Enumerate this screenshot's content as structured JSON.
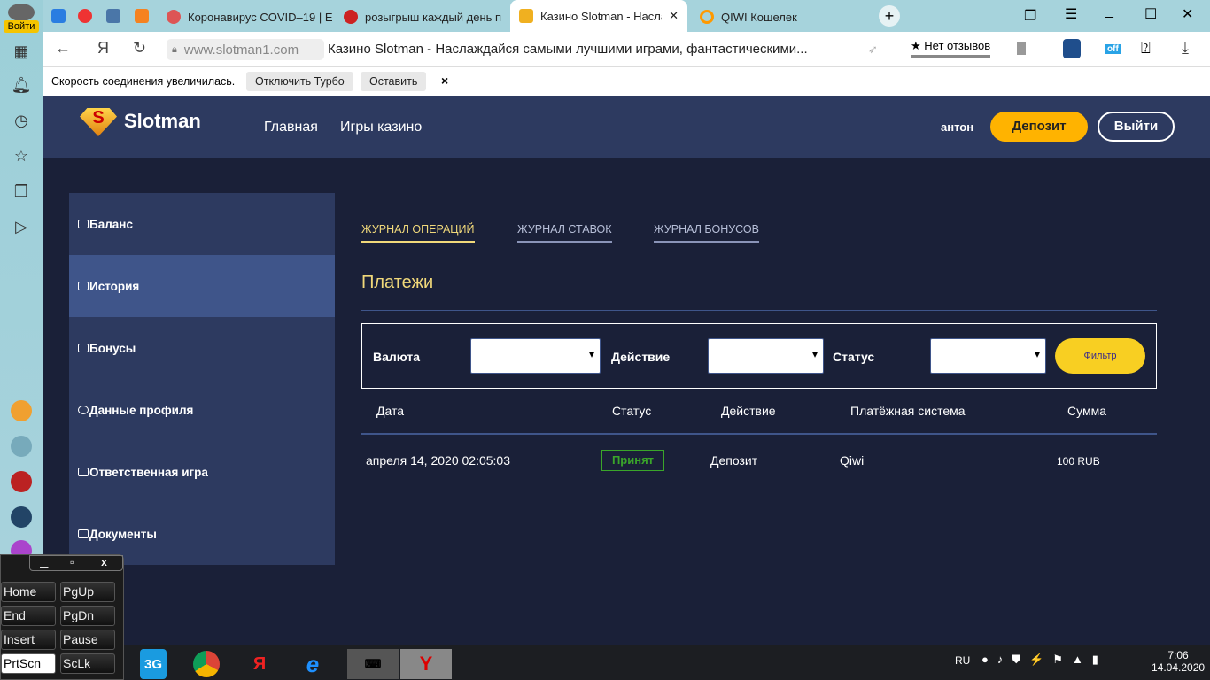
{
  "browser": {
    "login_label": "Войти",
    "tabs": [
      {
        "title": "Коронавирус COVID–19 | E"
      },
      {
        "title": "розыгрыш каждый день п"
      },
      {
        "title": "Казино Slotman - Насла"
      },
      {
        "title": "QIWI Кошелек"
      }
    ],
    "url": "www.slotman1.com",
    "page_title": "Казино Slotman - Наслаждайся самыми лучшими играми, фантастическими...",
    "reviews": "★ Нет отзывов",
    "ext_off": "off",
    "turbo": {
      "message": "Скорость соединения увеличилась.",
      "disable": "Отключить Турбо",
      "keep": "Оставить",
      "close": "×"
    }
  },
  "site": {
    "logo": "Slotman",
    "nav": [
      "Главная",
      "Игры казино"
    ],
    "username": "антон",
    "deposit": "Депозит",
    "logout": "Выйти",
    "sidebar": [
      {
        "label": "Баланс"
      },
      {
        "label": "История",
        "active": true
      },
      {
        "label": "Бонусы"
      },
      {
        "label": "Данные профиля"
      },
      {
        "label": "Ответственная игра"
      },
      {
        "label": "Документы"
      }
    ],
    "tabs": [
      "ЖУРНАЛ ОПЕРАЦИЙ",
      "ЖУРНАЛ СТАВОК",
      "ЖУРНАЛ БОНУСОВ"
    ],
    "section_title": "Платежи",
    "filters": {
      "currency": "Валюта",
      "action": "Действие",
      "status": "Статус",
      "button": "Фильтр"
    },
    "table": {
      "headers": [
        "Дата",
        "Статус",
        "Действие",
        "Платёжная система",
        "Сумма"
      ],
      "rows": [
        {
          "date": "апреля 14, 2020 02:05:03",
          "status": "Принят",
          "action": "Депозит",
          "system": "Qiwi",
          "amount": "100 RUB"
        }
      ]
    },
    "colors": {
      "header": "#2d3a60",
      "bg": "#1a2038",
      "accent": "#f0d87a",
      "deposit": "#ffb300",
      "filter": "#f8cf22",
      "ok": "#3aa52a"
    }
  },
  "keyboard": {
    "keys": [
      "Home",
      "PgUp",
      "End",
      "PgDn",
      "Insert",
      "Pause",
      "PrtScn",
      "ScLk"
    ],
    "win_close": "x"
  },
  "taskbar": {
    "net": "3G",
    "lang": "RU",
    "time": "7:06",
    "date": "14.04.2020"
  }
}
